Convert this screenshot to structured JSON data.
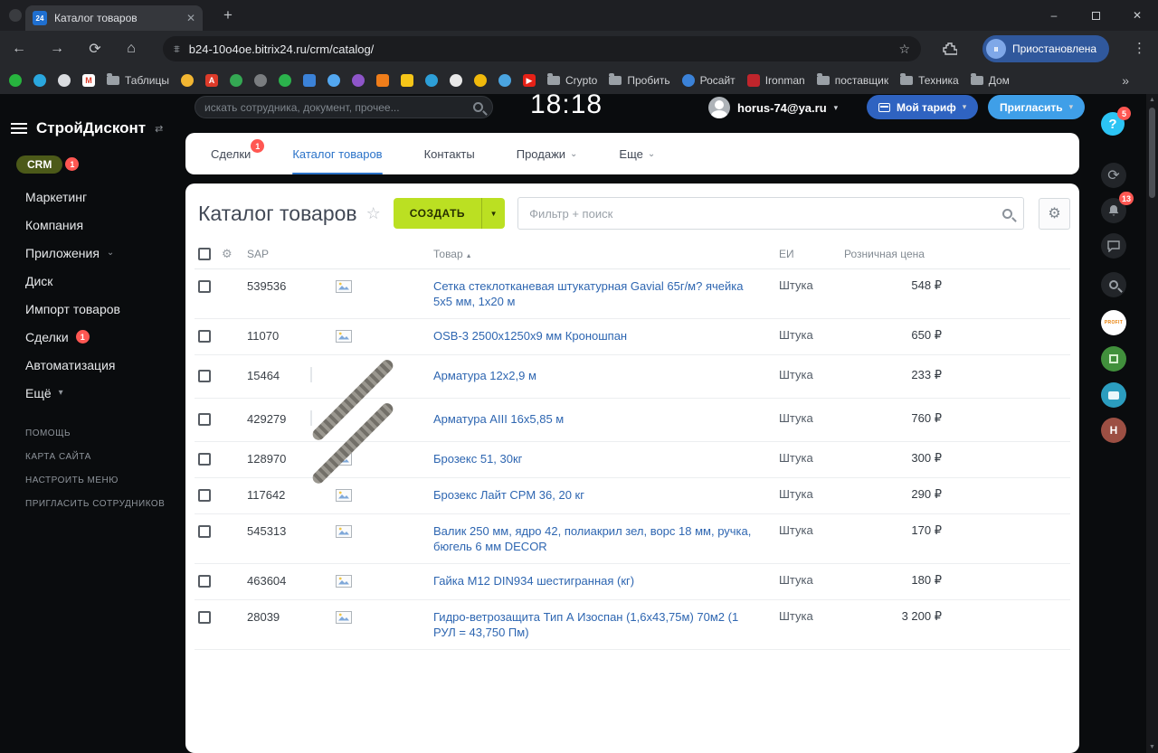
{
  "browser": {
    "tab_title": "Каталог товаров",
    "url": "b24-10o4oe.bitrix24.ru/crm/catalog/",
    "profile_label": "Приостановлена",
    "bookmark_labels": [
      "Таблицы",
      "Crypto",
      "Пробить",
      "Росайт",
      "Ironman",
      "поставщик",
      "Техника",
      "Дом",
      "»"
    ]
  },
  "sidebar": {
    "company": "СтройДисконт",
    "crm": {
      "label": "CRM",
      "badge": "1"
    },
    "items": [
      {
        "label": "Маркетинг"
      },
      {
        "label": "Компания"
      },
      {
        "label": "Приложения"
      },
      {
        "label": "Диск"
      },
      {
        "label": "Импорт товаров"
      },
      {
        "label": "Сделки",
        "badge": "1"
      },
      {
        "label": "Автоматизация"
      },
      {
        "label": "Ещё"
      }
    ],
    "footer": [
      "ПОМОЩЬ",
      "КАРТА САЙТА",
      "НАСТРОИТЬ МЕНЮ",
      "ПРИГЛАСИТЬ СОТРУДНИКОВ"
    ]
  },
  "topbar": {
    "search_placeholder": "искать сотрудника, документ, прочее...",
    "clock": "18:18",
    "user_email": "horus-74@ya.ru",
    "tariff_label": "Мой тариф",
    "invite_label": "Пригласить"
  },
  "nav_tabs": [
    {
      "label": "Сделки",
      "badge": "1"
    },
    {
      "label": "Каталог товаров"
    },
    {
      "label": "Контакты"
    },
    {
      "label": "Продажи"
    },
    {
      "label": "Еще"
    }
  ],
  "page": {
    "title": "Каталог товаров",
    "create_label": "СОЗДАТЬ",
    "filter_placeholder": "Фильтр + поиск"
  },
  "table": {
    "headers": {
      "sap": "SAP",
      "product": "Товар",
      "unit": "ЕИ",
      "price": "Розничная цена"
    },
    "rows": [
      {
        "sap": "539536",
        "name": "Сетка стеклотканевая штукатурная Gavial 65г/м? ячейка 5х5 мм, 1х20 м",
        "unit": "Штука",
        "price": "548 ₽"
      },
      {
        "sap": "11070",
        "name": "OSB-3 2500х1250х9 мм Кроношпан",
        "unit": "Штука",
        "price": "650 ₽"
      },
      {
        "sap": "15464",
        "name": "Арматура 12х2,9 м",
        "unit": "Штука",
        "price": "233 ₽"
      },
      {
        "sap": "429279",
        "name": "Арматура АIII 16х5,85 м",
        "unit": "Штука",
        "price": "760 ₽"
      },
      {
        "sap": "128970",
        "name": "Брозекс 51, 30кг",
        "unit": "Штука",
        "price": "300 ₽"
      },
      {
        "sap": "117642",
        "name": "Брозекс Лайт СРМ 36, 20 кг",
        "unit": "Штука",
        "price": "290 ₽"
      },
      {
        "sap": "545313",
        "name": "Валик 250 мм, ядро 42, полиакрил зел, ворс 18 мм, ручка, бюгель 6 мм DECOR",
        "unit": "Штука",
        "price": "170 ₽"
      },
      {
        "sap": "463604",
        "name": "Гайка М12 DIN934 шестигранная (кг)",
        "unit": "Штука",
        "price": "180 ₽"
      },
      {
        "sap": "28039",
        "name": "Гидро-ветрозащита Тип А Изоспан (1,6х43,75м) 70м2 (1 РУЛ = 43,750 Пм)",
        "unit": "Штука",
        "price": "3 200 ₽"
      }
    ]
  },
  "right_rail": {
    "help_badge": "5",
    "notifications_badge": "13",
    "profit_label": "PROFIT",
    "workspace_initial": "H"
  },
  "colors": {
    "accent_blue": "#2a72c8",
    "link_blue": "#2e66b1",
    "create_green": "#bbe022",
    "badge_red": "#ff5752",
    "crm_olive": "#4c5a19"
  }
}
